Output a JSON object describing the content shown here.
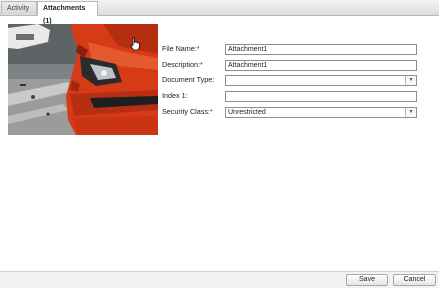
{
  "tabs": [
    {
      "label": "Activity"
    },
    {
      "label": "Attachments (1)"
    }
  ],
  "form": {
    "file_name": {
      "label": "File Name:",
      "required": "*",
      "value": "Attachment1"
    },
    "description": {
      "label": "Description:",
      "required": "*",
      "value": "Attachment1"
    },
    "document_type": {
      "label": "Document Type:",
      "value": ""
    },
    "index1": {
      "label": "Index 1:",
      "value": ""
    },
    "security_class": {
      "label": "Security Class:",
      "required": "*",
      "value": "Unrestricted"
    }
  },
  "footer": {
    "save_label": "Save",
    "cancel_label": "Cancel"
  },
  "colors": {
    "required_marker": "#d00000",
    "car_body": "#d63a16"
  },
  "icons": {
    "cursor": "hand-cursor-icon",
    "dropdown": "chevron-down-icon"
  }
}
